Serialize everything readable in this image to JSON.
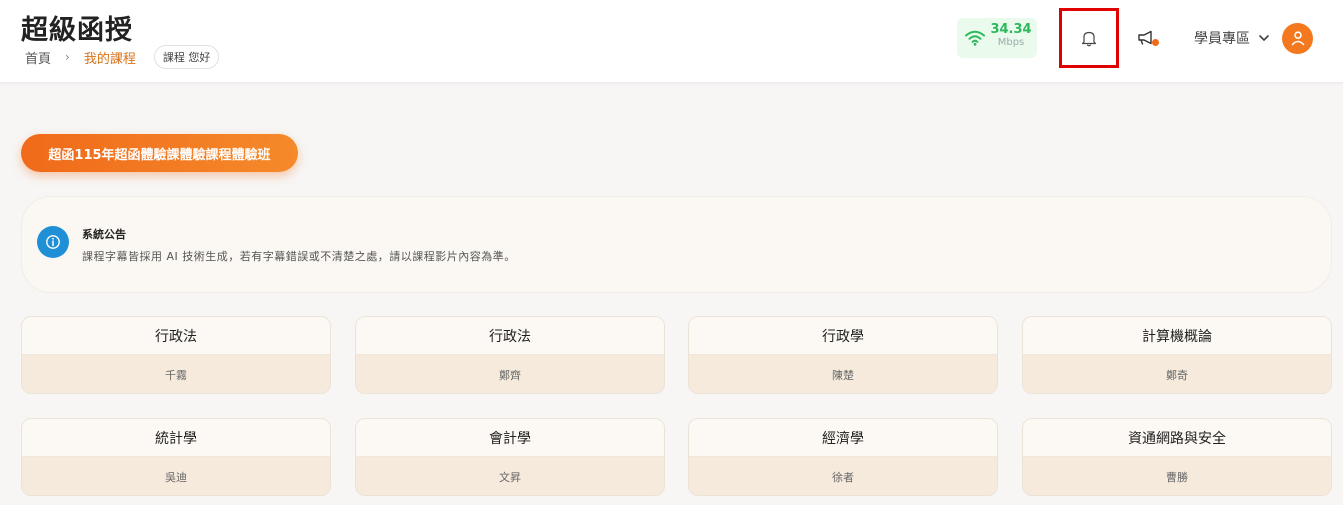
{
  "header": {
    "brand": "超級函授",
    "breadcrumb": {
      "home": "首頁",
      "separator": "›",
      "current": "我的課程",
      "greeting": "課程 您好"
    },
    "network": {
      "speed": "34.34",
      "unit": "Mbps",
      "color": "#2eb85c"
    },
    "user_menu_label": "學員專區",
    "icons": [
      "wifi-icon",
      "bell-icon",
      "megaphone-icon",
      "chevron-down-icon",
      "user-icon"
    ]
  },
  "class_button": {
    "label": "超函115年超函體驗課體驗課程體驗班"
  },
  "announcement": {
    "title": "系統公告",
    "text": "課程字幕皆採用 AI 技術生成，若有字幕錯誤或不清楚之處，請以課程影片內容為準。"
  },
  "courses": [
    {
      "subject": "行政法",
      "teacher": "千霧"
    },
    {
      "subject": "行政法",
      "teacher": "鄭齊"
    },
    {
      "subject": "行政學",
      "teacher": "陳楚"
    },
    {
      "subject": "計算機概論",
      "teacher": "鄭奇"
    },
    {
      "subject": "統計學",
      "teacher": "吳迪"
    },
    {
      "subject": "會計學",
      "teacher": "文昇"
    },
    {
      "subject": "經濟學",
      "teacher": "徐者"
    },
    {
      "subject": "資通網路與安全",
      "teacher": "曹勝"
    }
  ],
  "colors": {
    "accent": "#f06a1a",
    "link": "#d9731a",
    "info": "#1f8fd6",
    "highlight": "#e00000"
  }
}
